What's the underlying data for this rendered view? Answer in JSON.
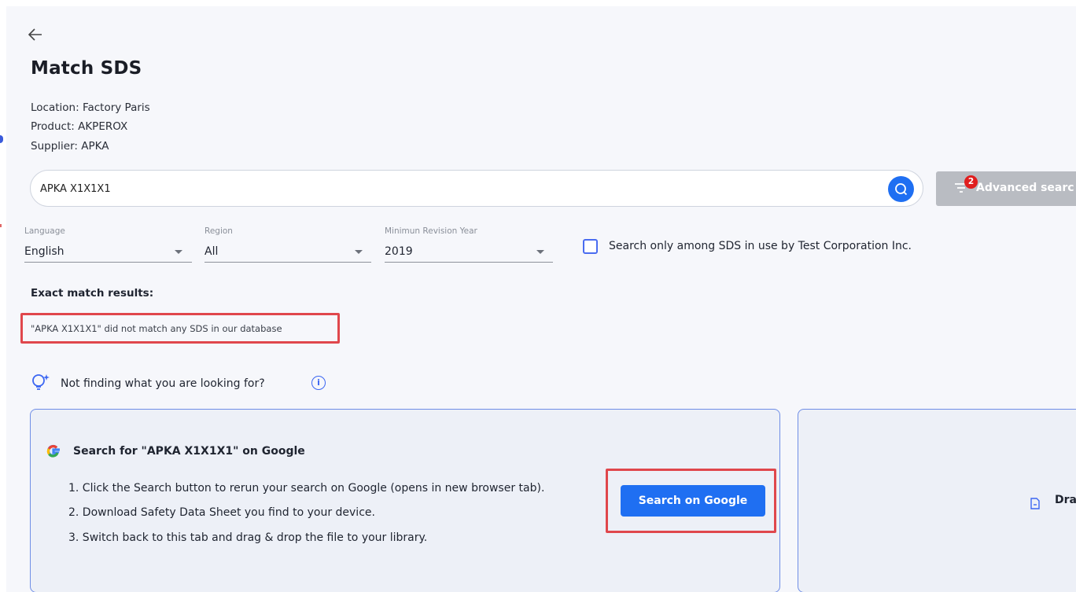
{
  "page": {
    "title": "Match SDS",
    "location": "Location: Factory Paris",
    "product": "Product: AKPEROX",
    "supplier": "Supplier: APKA"
  },
  "search": {
    "value": "APKA X1X1X1",
    "advanced_label": "Advanced searc",
    "advanced_badge": "2"
  },
  "filters": {
    "language": {
      "label": "Language",
      "value": "English"
    },
    "region": {
      "label": "Region",
      "value": "All"
    },
    "revision_year": {
      "label": "Minimun Revision Year",
      "value": "2019"
    },
    "in_use_checkbox": {
      "label": "Search only among SDS in use by Test Corporation Inc.",
      "checked": false
    }
  },
  "results": {
    "heading": "Exact match results:",
    "no_match_message": "\"APKA X1X1X1\" did not match any SDS in our database"
  },
  "help": {
    "prompt": "Not finding what you are looking for?",
    "info_glyph": "i"
  },
  "google_card": {
    "title": "Search for \"APKA X1X1X1\" on Google",
    "steps": [
      "1. Click the Search button to rerun your search on Google (opens in new browser tab).",
      "2. Download Safety Data Sheet you find to your device.",
      "3. Switch back to this tab and drag & drop the file to your library."
    ],
    "button_label": "Search on Google"
  },
  "upload_card": {
    "label": "Dra"
  },
  "colors": {
    "primary": "#1f6ff2",
    "highlight": "#e0474c",
    "disabled": "#b9bcc2",
    "card_border": "#6f8ee6",
    "background": "#f6f7fb"
  },
  "icons": {
    "back": "arrow-left-icon",
    "search": "search-icon",
    "filter": "filter-icon",
    "dropdown": "chevron-down-icon",
    "lightbulb": "lightbulb-sparkle-icon",
    "info": "info-icon",
    "google": "google-logo-icon",
    "file": "file-icon"
  }
}
